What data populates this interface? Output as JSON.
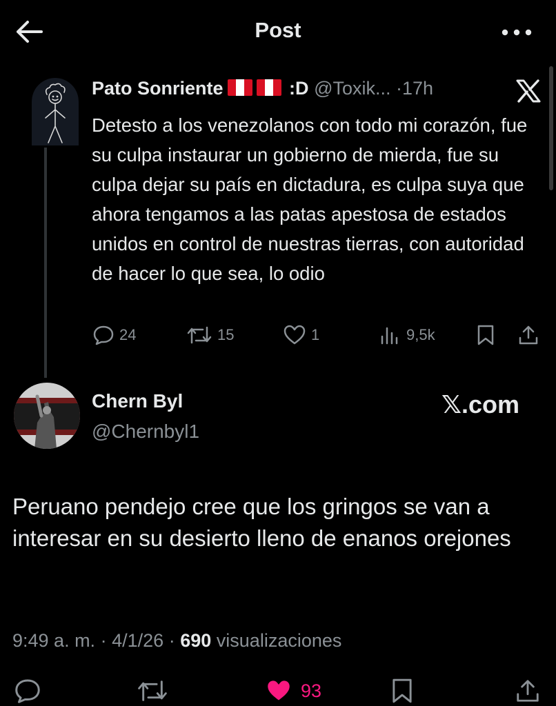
{
  "topbar": {
    "title": "Post"
  },
  "quoted_post": {
    "author_name": "Pato Sonriente",
    "name_suffix": ":D",
    "handle": "@Toxik...",
    "separator": "·",
    "time": "17h",
    "body": "Detesto a los venezolanos con todo mi corazón, fue su culpa instaurar un gobierno de mierda, fue su culpa dejar su país en dictadura, es culpa suya que ahora tengamos a las patas apestosa de estados unidos en control de nuestras tierras, con autoridad de hacer lo que sea, lo odio",
    "stats": {
      "replies": "24",
      "reposts": "15",
      "likes": "1",
      "views": "9,5k"
    },
    "icons": [
      "reply-icon",
      "repost-icon",
      "like-icon",
      "views-icon",
      "bookmark-icon",
      "share-icon"
    ]
  },
  "post": {
    "author_name": "Chern Byl",
    "handle": "@Chernbyl1",
    "source": "𝕏.com",
    "body": "Peruano pendejo cree que los gringos se van a interesar en su desierto lleno de enanos orejones",
    "time": "9:49 a. m.",
    "sep1": "·",
    "date": "4/1/26",
    "sep2": "·",
    "views_count": "690",
    "views_label": "visualizaciones",
    "likes": "93"
  },
  "colors": {
    "background": "#000000",
    "text": "#e7e9ea",
    "muted": "#8b9196",
    "like": "#f91880"
  }
}
